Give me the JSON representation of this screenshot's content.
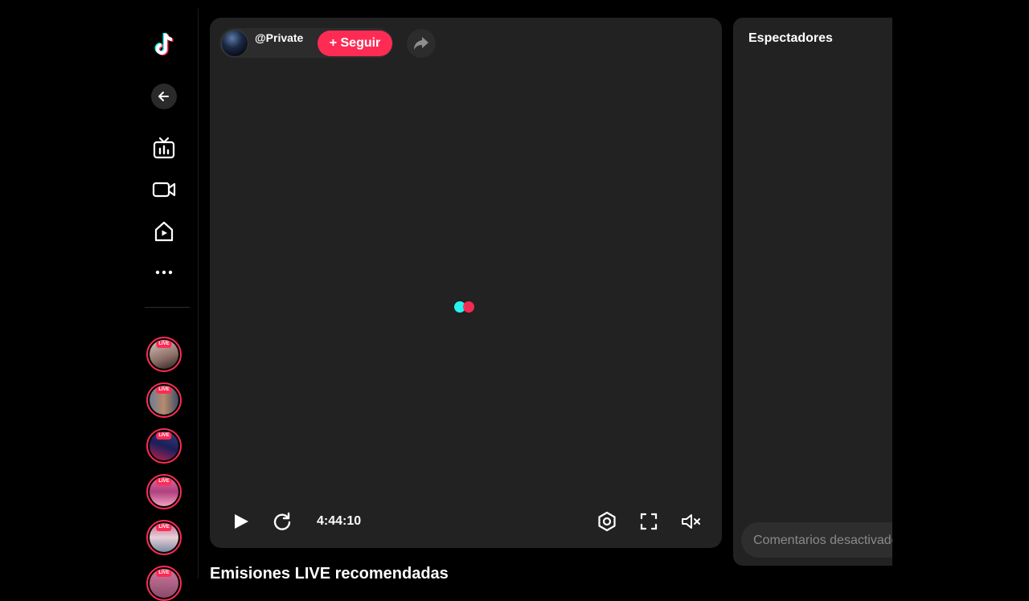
{
  "sidebar": {
    "logo_icon": "tiktok-logo-icon",
    "back_icon": "arrow-left-icon",
    "nav_items": [
      {
        "name": "live-tv-icon"
      },
      {
        "name": "video-camera-icon"
      },
      {
        "name": "home-play-icon"
      },
      {
        "name": "more-dots-icon"
      }
    ],
    "live_badge": "LIVE",
    "live_accounts_count": 6
  },
  "player": {
    "host_name": "@Private",
    "follow_label": "+ Seguir",
    "time": "4:44:10",
    "controls": [
      "play-icon",
      "refresh-icon",
      "settings-icon",
      "fullscreen-icon",
      "mute-icon"
    ]
  },
  "viewers": {
    "title": "Espectadores",
    "comments_placeholder": "Comentarios desactivados"
  },
  "recommended": {
    "title": "Emisiones LIVE recomendadas"
  },
  "colors": {
    "accent": "#fe2c55",
    "cyan": "#25f4ee",
    "panel": "#222222",
    "background": "#000000"
  }
}
